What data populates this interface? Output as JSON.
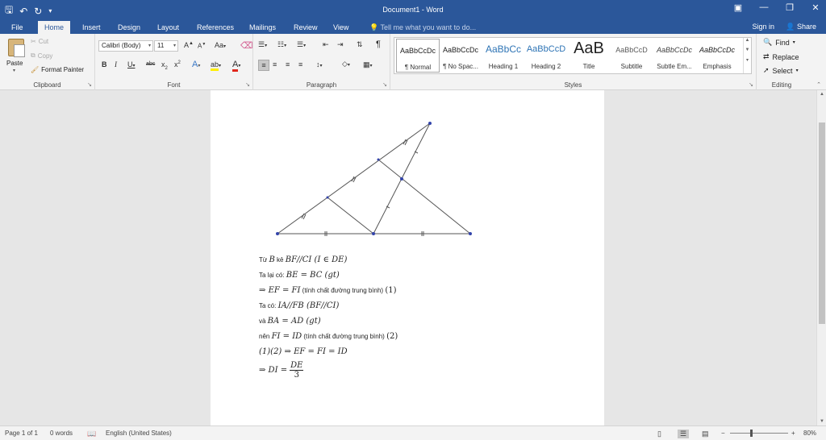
{
  "title": "Document1 - Word",
  "qat": {
    "save_icon": "save-icon",
    "undo_icon": "undo-icon",
    "redo_icon": "redo-icon"
  },
  "tabs": [
    "File",
    "Home",
    "Insert",
    "Design",
    "Layout",
    "References",
    "Mailings",
    "Review",
    "View"
  ],
  "active_tab": "Home",
  "tell_me": "Tell me what you want to do...",
  "sign_in": "Sign in",
  "share": "Share",
  "clipboard": {
    "paste": "Paste",
    "cut": "Cut",
    "copy": "Copy",
    "format_painter": "Format Painter",
    "label": "Clipboard"
  },
  "font": {
    "name": "Calibri (Body)",
    "size": "11",
    "label": "Font"
  },
  "paragraph": {
    "label": "Paragraph"
  },
  "styles": {
    "label": "Styles",
    "items": [
      {
        "sample": "AaBbCcDc",
        "name": "¶ Normal"
      },
      {
        "sample": "AaBbCcDc",
        "name": "¶ No Spac..."
      },
      {
        "sample": "AaBbCc",
        "name": "Heading 1"
      },
      {
        "sample": "AaBbCcD",
        "name": "Heading 2"
      },
      {
        "sample": "AaB",
        "name": "Title"
      },
      {
        "sample": "AaBbCcD",
        "name": "Subtitle"
      },
      {
        "sample": "AaBbCcDc",
        "name": "Subtle Em..."
      },
      {
        "sample": "AaBbCcDc",
        "name": "Emphasis"
      }
    ]
  },
  "editing": {
    "find": "Find",
    "replace": "Replace",
    "select": "Select",
    "label": "Editing"
  },
  "document": {
    "lines": [
      {
        "pre": "Từ ",
        "math": "B",
        "mid": " kẻ ",
        "math2": "BF//CI (I ∈ DE)",
        "note": "",
        "tail": ""
      },
      {
        "pre": "Ta lại có: ",
        "math": "BE = BC (gt)",
        "mid": "",
        "math2": "",
        "note": "",
        "tail": ""
      },
      {
        "pre": "⇒ ",
        "math": "EF = FI",
        "mid": "",
        "math2": "",
        "note": " (tính chất đường trung bình) ",
        "tail": "(1)"
      },
      {
        "pre": "Ta có: ",
        "math": "IA//FB (BF//CI)",
        "mid": "",
        "math2": "",
        "note": "",
        "tail": ""
      },
      {
        "pre": "và ",
        "math": "BA = AD (gt)",
        "mid": "",
        "math2": "",
        "note": "",
        "tail": ""
      },
      {
        "pre": "nên ",
        "math": "FI = ID",
        "mid": "",
        "math2": "",
        "note": " (tính chất đường trung bình) ",
        "tail": "(2)"
      },
      {
        "pre": "",
        "math": "(1)(2) ⇒ EF = FI = ID",
        "mid": "",
        "math2": "",
        "note": "",
        "tail": ""
      }
    ],
    "final_lhs": "⇒ DI =",
    "final_num": "DE",
    "final_den": "3"
  },
  "status": {
    "page": "Page 1 of 1",
    "words": "0 words",
    "language": "English (United States)",
    "zoom": "80%"
  }
}
